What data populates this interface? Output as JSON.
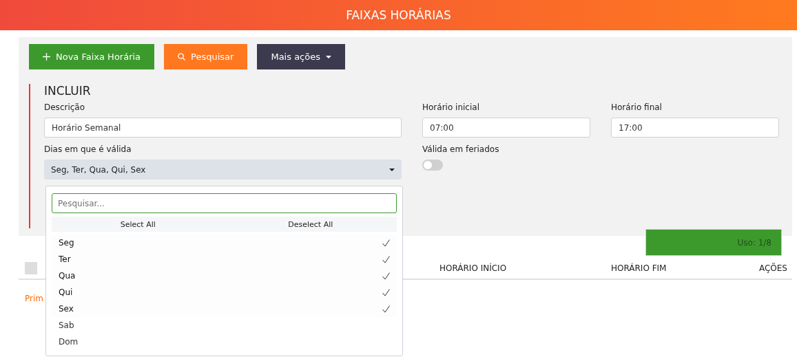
{
  "header": {
    "title": "FAIXAS HORÁRIAS"
  },
  "toolbar": [
    {
      "kind": "add",
      "label": "Nova Faixa Horária"
    },
    {
      "kind": "search",
      "label": "Pesquisar"
    },
    {
      "kind": "menu",
      "label": "Mais ações"
    }
  ],
  "form": {
    "title": "INCLUIR",
    "description": {
      "label": "Descrição",
      "value": "Horário Semanal"
    },
    "start_time": {
      "label": "Horário inicial",
      "value": "07:00"
    },
    "end_time": {
      "label": "Horário final",
      "value": "17:00"
    },
    "days": {
      "label": "Dias em que é válida",
      "value": "Seg, Ter, Qua, Qui, Sex",
      "expanded": true,
      "search_placeholder": "Pesquisar...",
      "select_all": "Select All",
      "deselect_all": "Deselect All",
      "options": [
        {
          "label": "Seg",
          "selected": true
        },
        {
          "label": "Ter",
          "selected": true
        },
        {
          "label": "Qua",
          "selected": true
        },
        {
          "label": "Qui",
          "selected": true
        },
        {
          "label": "Sex",
          "selected": true
        },
        {
          "label": "Sab",
          "selected": false
        },
        {
          "label": "Dom",
          "selected": false
        }
      ]
    },
    "holidays": {
      "label": "Válida em feriados",
      "on": false
    }
  },
  "usage": {
    "label": "Uso: 1/8"
  },
  "table": {
    "select_all_checked": false,
    "columns": [
      "HORÁRIO INÍCIO",
      "HORÁRIO FIM",
      "AÇÕES"
    ]
  },
  "pagination": {
    "first": "Prim"
  }
}
